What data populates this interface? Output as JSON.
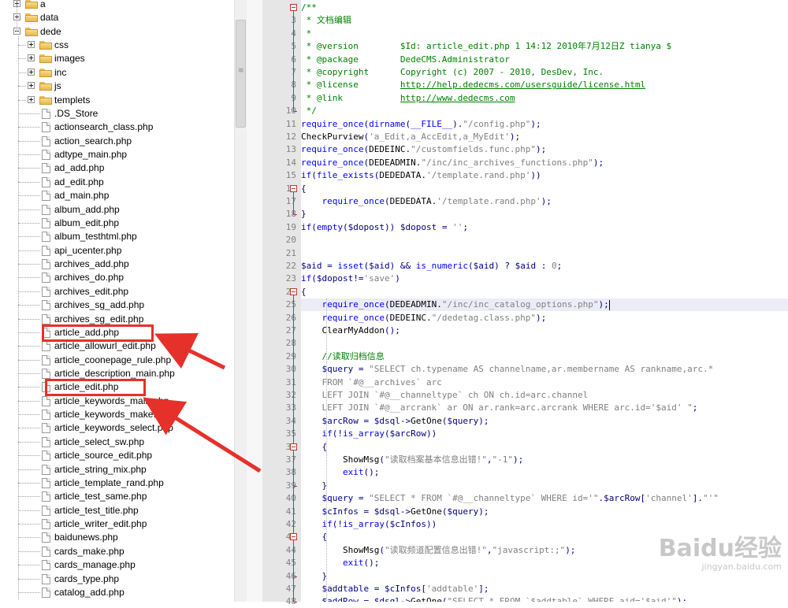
{
  "tree": {
    "top_items": [
      {
        "name": "a",
        "type": "folder",
        "expander": "plus"
      },
      {
        "name": "data",
        "type": "folder",
        "expander": "plus"
      },
      {
        "name": "dede",
        "type": "folder",
        "expander": "minus"
      }
    ],
    "dede_folders": [
      "css",
      "images",
      "inc",
      "js",
      "templets"
    ],
    "dede_files": [
      ".DS_Store",
      "actionsearch_class.php",
      "action_search.php",
      "adtype_main.php",
      "ad_add.php",
      "ad_edit.php",
      "ad_main.php",
      "album_add.php",
      "album_edit.php",
      "album_testhtml.php",
      "api_ucenter.php",
      "archives_add.php",
      "archives_do.php",
      "archives_edit.php",
      "archives_sg_add.php",
      "archives_sg_edit.php",
      "article_add.php",
      "article_allowurl_edit.php",
      "article_coonepage_rule.php",
      "article_description_main.php",
      "article_edit.php",
      "article_keywords_main.php",
      "article_keywords_make.php",
      "article_keywords_select.php",
      "article_select_sw.php",
      "article_source_edit.php",
      "article_string_mix.php",
      "article_template_rand.php",
      "article_test_same.php",
      "article_test_title.php",
      "article_writer_edit.php",
      "baidunews.php",
      "cards_make.php",
      "cards_manage.php",
      "cards_type.php",
      "catalog_add.php"
    ],
    "highlighted": [
      "article_add.php",
      "article_edit.php"
    ]
  },
  "editor": {
    "first_line": 2,
    "current_line": 25,
    "lines": [
      [
        [
          "c-comment",
          "/**"
        ]
      ],
      [
        [
          "c-comment",
          " * 文档编辑"
        ]
      ],
      [
        [
          "c-comment",
          " *"
        ]
      ],
      [
        [
          "c-comment",
          " * @version        $Id: article_edit.php 1 14:12 2010年7月12日Z tianya $"
        ]
      ],
      [
        [
          "c-comment",
          " * @package        DedeCMS.Administrator"
        ]
      ],
      [
        [
          "c-comment",
          " * @copyright      Copyright (c) 2007 - 2010, DesDev, Inc."
        ]
      ],
      [
        [
          "c-comment",
          " * @license        "
        ],
        [
          "c-link",
          "http://help.dedecms.com/usersguide/license.html"
        ]
      ],
      [
        [
          "c-comment",
          " * @link           "
        ],
        [
          "c-link",
          "http://www.dedecms.com"
        ]
      ],
      [
        [
          "c-comment",
          " */"
        ]
      ],
      [
        [
          "c-fn",
          "require_once"
        ],
        [
          "c-op",
          "("
        ],
        [
          "c-fn",
          "dirname"
        ],
        [
          "c-op",
          "("
        ],
        [
          "c-cn",
          "__FILE__"
        ],
        [
          "c-op",
          ")."
        ],
        [
          "c-str",
          "\"/config.php\""
        ],
        [
          "c-op",
          ");"
        ]
      ],
      [
        [
          "c-const",
          "CheckPurview"
        ],
        [
          "c-op",
          "("
        ],
        [
          "c-str",
          "'a_Edit,a_AccEdit,a_MyEdit'"
        ],
        [
          "c-op",
          ");"
        ]
      ],
      [
        [
          "c-fn",
          "require_once"
        ],
        [
          "c-op",
          "("
        ],
        [
          "c-const",
          "DEDEINC"
        ],
        [
          "c-op",
          "."
        ],
        [
          "c-str",
          "\"/customfields.func.php\""
        ],
        [
          "c-op",
          ");"
        ]
      ],
      [
        [
          "c-fn",
          "require_once"
        ],
        [
          "c-op",
          "("
        ],
        [
          "c-const",
          "DEDEADMIN"
        ],
        [
          "c-op",
          "."
        ],
        [
          "c-str",
          "\"/inc/inc_archives_functions.php\""
        ],
        [
          "c-op",
          ");"
        ]
      ],
      [
        [
          "c-fn",
          "if"
        ],
        [
          "c-op",
          "("
        ],
        [
          "c-fn",
          "file_exists"
        ],
        [
          "c-op",
          "("
        ],
        [
          "c-const",
          "DEDEDATA"
        ],
        [
          "c-op",
          "."
        ],
        [
          "c-str",
          "'/template.rand.php'"
        ],
        [
          "c-op",
          "))"
        ]
      ],
      [
        [
          "c-op",
          "{"
        ]
      ],
      [
        [
          "c-op",
          "    "
        ],
        [
          "c-fn",
          "require_once"
        ],
        [
          "c-op",
          "("
        ],
        [
          "c-const",
          "DEDEDATA"
        ],
        [
          "c-op",
          "."
        ],
        [
          "c-str",
          "'/template.rand.php'"
        ],
        [
          "c-op",
          ");"
        ]
      ],
      [
        [
          "c-op",
          "}"
        ]
      ],
      [
        [
          "c-fn",
          "if"
        ],
        [
          "c-op",
          "("
        ],
        [
          "c-fn",
          "empty"
        ],
        [
          "c-op",
          "("
        ],
        [
          "c-var",
          "$dopost"
        ],
        [
          "c-op",
          ")) "
        ],
        [
          "c-var",
          "$dopost"
        ],
        [
          "c-op",
          " = "
        ],
        [
          "c-str",
          "''"
        ],
        [
          "c-op",
          ";"
        ]
      ],
      [],
      [],
      [
        [
          "c-var",
          "$aid"
        ],
        [
          "c-op",
          " = "
        ],
        [
          "c-fn",
          "isset"
        ],
        [
          "c-op",
          "("
        ],
        [
          "c-var",
          "$aid"
        ],
        [
          "c-op",
          ") && "
        ],
        [
          "c-fn",
          "is_numeric"
        ],
        [
          "c-op",
          "("
        ],
        [
          "c-var",
          "$aid"
        ],
        [
          "c-op",
          ") ? "
        ],
        [
          "c-var",
          "$aid"
        ],
        [
          "c-op",
          " : "
        ],
        [
          "c-str",
          "0"
        ],
        [
          "c-op",
          ";"
        ]
      ],
      [
        [
          "c-fn",
          "if"
        ],
        [
          "c-op",
          "("
        ],
        [
          "c-var",
          "$dopost"
        ],
        [
          "c-op",
          "!="
        ],
        [
          "c-str",
          "'save'"
        ],
        [
          "c-op",
          ")"
        ]
      ],
      [
        [
          "c-op",
          "{"
        ]
      ],
      [
        [
          "c-op",
          "    "
        ],
        [
          "c-fn",
          "require_once"
        ],
        [
          "c-op",
          "("
        ],
        [
          "c-const",
          "DEDEADMIN"
        ],
        [
          "c-op",
          "."
        ],
        [
          "c-str",
          "\"/inc/inc_catalog_options.php\""
        ],
        [
          "c-op",
          ");"
        ]
      ],
      [
        [
          "c-op",
          "    "
        ],
        [
          "c-fn",
          "require_once"
        ],
        [
          "c-op",
          "("
        ],
        [
          "c-const",
          "DEDEINC"
        ],
        [
          "c-op",
          "."
        ],
        [
          "c-str",
          "\"/dedetag.class.php\""
        ],
        [
          "c-op",
          ");"
        ]
      ],
      [
        [
          "c-op",
          "    "
        ],
        [
          "c-const",
          "ClearMyAddon"
        ],
        [
          "c-op",
          "();"
        ]
      ],
      [],
      [
        [
          "c-op",
          "    "
        ],
        [
          "c-comment",
          "//读取归档信息"
        ]
      ],
      [
        [
          "c-op",
          "    "
        ],
        [
          "c-var",
          "$query"
        ],
        [
          "c-op",
          " = "
        ],
        [
          "c-str",
          "\"SELECT ch.typename AS channelname,ar.membername AS rankname,arc.*"
        ]
      ],
      [
        [
          "c-str",
          "    FROM `#@__archives` arc"
        ]
      ],
      [
        [
          "c-str",
          "    LEFT JOIN `#@__channeltype` ch ON ch.id=arc.channel"
        ]
      ],
      [
        [
          "c-str",
          "    LEFT JOIN `#@__arcrank` ar ON ar.rank=arc.arcrank WHERE arc.id='$aid' \""
        ],
        [
          "c-op",
          ";"
        ]
      ],
      [
        [
          "c-op",
          "    "
        ],
        [
          "c-var",
          "$arcRow"
        ],
        [
          "c-op",
          " = "
        ],
        [
          "c-var",
          "$dsql"
        ],
        [
          "c-op",
          "->"
        ],
        [
          "c-const",
          "GetOne"
        ],
        [
          "c-op",
          "("
        ],
        [
          "c-var",
          "$query"
        ],
        [
          "c-op",
          ");"
        ]
      ],
      [
        [
          "c-op",
          "    "
        ],
        [
          "c-fn",
          "if"
        ],
        [
          "c-op",
          "(!"
        ],
        [
          "c-fn",
          "is_array"
        ],
        [
          "c-op",
          "("
        ],
        [
          "c-var",
          "$arcRow"
        ],
        [
          "c-op",
          "))"
        ]
      ],
      [
        [
          "c-op",
          "    {"
        ]
      ],
      [
        [
          "c-op",
          "        "
        ],
        [
          "c-const",
          "ShowMsg"
        ],
        [
          "c-op",
          "("
        ],
        [
          "c-str",
          "\"读取档案基本信息出错!\""
        ],
        [
          "c-op",
          ","
        ],
        [
          "c-str",
          "\"-1\""
        ],
        [
          "c-op",
          ");"
        ]
      ],
      [
        [
          "c-op",
          "        "
        ],
        [
          "c-fn",
          "exit"
        ],
        [
          "c-op",
          "();"
        ]
      ],
      [
        [
          "c-op",
          "    }"
        ]
      ],
      [
        [
          "c-op",
          "    "
        ],
        [
          "c-var",
          "$query"
        ],
        [
          "c-op",
          " = "
        ],
        [
          "c-str",
          "\"SELECT * FROM `#@__channeltype` WHERE id='\""
        ],
        [
          "c-op",
          "."
        ],
        [
          "c-var",
          "$arcRow"
        ],
        [
          "c-op",
          "["
        ],
        [
          "c-str",
          "'channel'"
        ],
        [
          "c-op",
          "]."
        ],
        [
          "c-str",
          "\"'\""
        ]
      ],
      [
        [
          "c-op",
          "    "
        ],
        [
          "c-var",
          "$cInfos"
        ],
        [
          "c-op",
          " = "
        ],
        [
          "c-var",
          "$dsql"
        ],
        [
          "c-op",
          "->"
        ],
        [
          "c-const",
          "GetOne"
        ],
        [
          "c-op",
          "("
        ],
        [
          "c-var",
          "$query"
        ],
        [
          "c-op",
          ");"
        ]
      ],
      [
        [
          "c-op",
          "    "
        ],
        [
          "c-fn",
          "if"
        ],
        [
          "c-op",
          "(!"
        ],
        [
          "c-fn",
          "is_array"
        ],
        [
          "c-op",
          "("
        ],
        [
          "c-var",
          "$cInfos"
        ],
        [
          "c-op",
          "))"
        ]
      ],
      [
        [
          "c-op",
          "    {"
        ]
      ],
      [
        [
          "c-op",
          "        "
        ],
        [
          "c-const",
          "ShowMsg"
        ],
        [
          "c-op",
          "("
        ],
        [
          "c-str",
          "\"读取频道配置信息出错!\""
        ],
        [
          "c-op",
          ","
        ],
        [
          "c-str",
          "\"javascript:;\""
        ],
        [
          "c-op",
          ");"
        ]
      ],
      [
        [
          "c-op",
          "        "
        ],
        [
          "c-fn",
          "exit"
        ],
        [
          "c-op",
          "();"
        ]
      ],
      [
        [
          "c-op",
          "    }"
        ]
      ],
      [
        [
          "c-op",
          "    "
        ],
        [
          "c-var",
          "$addtable"
        ],
        [
          "c-op",
          " = "
        ],
        [
          "c-var",
          "$cInfos"
        ],
        [
          "c-op",
          "["
        ],
        [
          "c-str",
          "'addtable'"
        ],
        [
          "c-op",
          "];"
        ]
      ],
      [
        [
          "c-op",
          "    "
        ],
        [
          "c-var",
          "$addRow"
        ],
        [
          "c-op",
          " = "
        ],
        [
          "c-var",
          "$dsql"
        ],
        [
          "c-op",
          "->"
        ],
        [
          "c-const",
          "GetOne"
        ],
        [
          "c-op",
          "("
        ],
        [
          "c-str",
          "\"SELECT * FROM `$addtable` WHERE aid='$aid'\""
        ],
        [
          "c-op",
          ");"
        ]
      ]
    ]
  },
  "watermark": {
    "brand": "Baidu经验",
    "url": "jingyan.baidu.com"
  },
  "colors": {
    "annotation_red": "#e6302a",
    "fold_marker": "#c0342c",
    "current_line": "#ececf7"
  }
}
